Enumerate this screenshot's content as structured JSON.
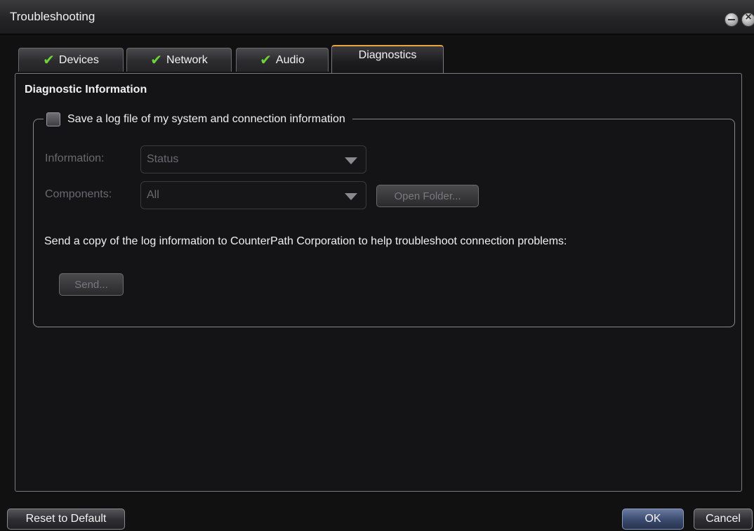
{
  "window": {
    "title": "Troubleshooting"
  },
  "tabs": [
    {
      "label": "Devices",
      "checked": true,
      "icon": "checkmark-icon"
    },
    {
      "label": "Network",
      "checked": true,
      "icon": "checkmark-icon"
    },
    {
      "label": "Audio",
      "checked": true,
      "icon": "checkmark-icon"
    },
    {
      "label": "Diagnostics",
      "checked": false,
      "active": true
    }
  ],
  "diagnostics": {
    "section_title": "Diagnostic Information",
    "save_log": {
      "label": "Save a log file of my system and connection information",
      "checked": false
    },
    "information": {
      "label": "Information:",
      "value": "Status",
      "enabled": false
    },
    "components": {
      "label": "Components:",
      "value": "All",
      "enabled": false
    },
    "open_folder_label": "Open Folder...",
    "send_text": "Send a copy of the log information to CounterPath Corporation to help troubleshoot connection problems:",
    "send_label": "Send..."
  },
  "footer": {
    "reset_label": "Reset to Default",
    "ok_label": "OK",
    "cancel_label": "Cancel"
  },
  "colors": {
    "active_tab_accent": "#e8a640",
    "check_green": "#6fd33a",
    "background": "#111112"
  }
}
